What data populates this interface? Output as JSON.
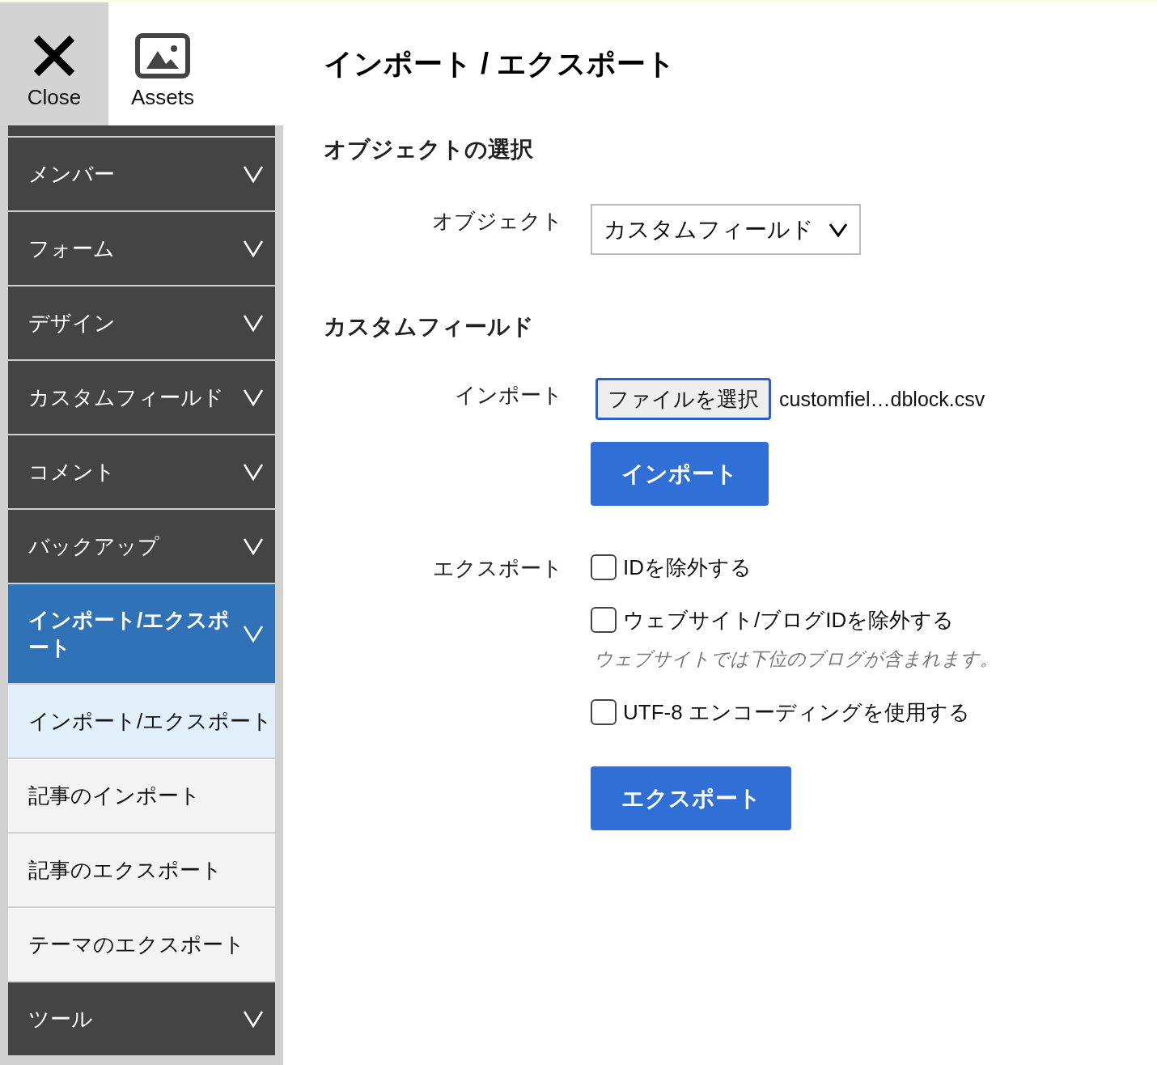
{
  "toolbar": [
    {
      "kind": "close",
      "label": "Close",
      "selected": true
    },
    {
      "kind": "assets",
      "label": "Assets",
      "selected": false
    }
  ],
  "sidebar": {
    "groups": [
      {
        "label": "メンバー",
        "expanded": false
      },
      {
        "label": "フォーム",
        "expanded": false
      },
      {
        "label": "デザイン",
        "expanded": false
      },
      {
        "label": "カスタムフィールド",
        "expanded": false
      },
      {
        "label": "コメント",
        "expanded": false
      },
      {
        "label": "バックアップ",
        "expanded": false
      },
      {
        "label": "インポート/エクスポート",
        "expanded": true,
        "children": [
          {
            "label": "インポート/エクスポート",
            "selected": true
          },
          {
            "label": "記事のインポート",
            "selected": false
          },
          {
            "label": "記事のエクスポート",
            "selected": false
          },
          {
            "label": "テーマのエクスポート",
            "selected": false
          }
        ]
      },
      {
        "label": "ツール",
        "expanded": false
      }
    ]
  },
  "main": {
    "title": "インポート / エクスポート",
    "object_section": {
      "heading": "オブジェクトの選択",
      "label": "オブジェクト",
      "value": "カスタムフィールド"
    },
    "field_section": {
      "heading": "カスタムフィールド",
      "import": {
        "label": "インポート",
        "file_button": "ファイルを選択",
        "file_name": "customfiel…dblock.csv",
        "button": "インポート"
      },
      "export": {
        "label": "エクスポート",
        "options": [
          {
            "label": "IDを除外する",
            "checked": false
          },
          {
            "label": "ウェブサイト/ブログIDを除外する",
            "checked": false,
            "note": "ウェブサイトでは下位のブログが含まれます。"
          },
          {
            "label": "UTF-8 エンコーディングを使用する",
            "checked": false
          }
        ],
        "button": "エクスポート"
      }
    }
  }
}
